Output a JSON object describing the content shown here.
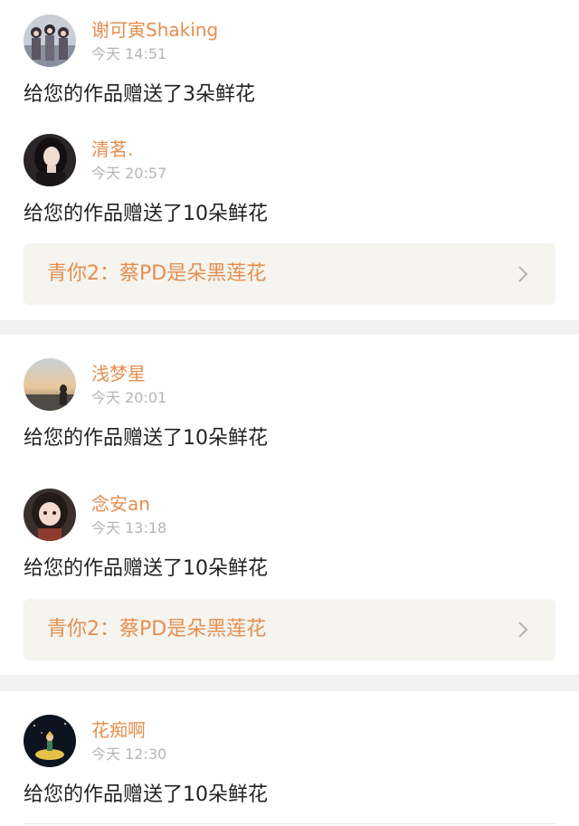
{
  "colors": {
    "accent": "#e58e4f",
    "time": "#b5b5b5",
    "text": "#222222",
    "card_bg": "#f5f4ef",
    "separator": "#f2f2f2"
  },
  "groups": [
    {
      "entries": [
        {
          "username": "谢可寅Shaking",
          "time": "今天 14:51",
          "message": "给您的作品赠送了3朵鲜花",
          "avatar": "avatar-group-photo"
        },
        {
          "username": "清茗.",
          "time": "今天 20:57",
          "message": "给您的作品赠送了10朵鲜花",
          "avatar": "avatar-portrait"
        }
      ],
      "work": {
        "title": "青你2：蔡PD是朵黑莲花",
        "icon": "chevron-right-icon"
      }
    },
    {
      "entries": [
        {
          "username": "浅梦星",
          "time": "今天 20:01",
          "message": "给您的作品赠送了10朵鲜花",
          "avatar": "avatar-sunset-silhouette"
        },
        {
          "username": "念安an",
          "time": "今天 13:18",
          "message": "给您的作品赠送了10朵鲜花",
          "avatar": "avatar-child-portrait"
        }
      ],
      "work": {
        "title": "青你2：蔡PD是朵黑莲花",
        "icon": "chevron-right-icon"
      }
    },
    {
      "entries": [
        {
          "username": "花痴啊",
          "time": "今天 12:30",
          "message": "给您的作品赠送了10朵鲜花",
          "avatar": "avatar-little-prince"
        }
      ]
    }
  ]
}
